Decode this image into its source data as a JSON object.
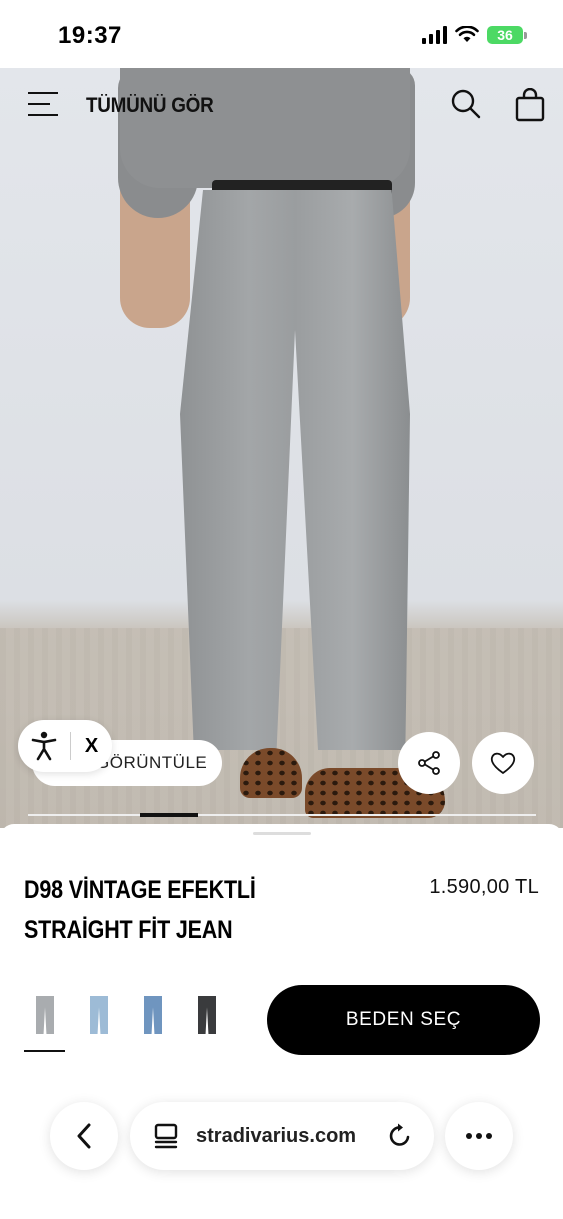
{
  "status_bar": {
    "time": "19:37",
    "battery": "36",
    "icons": [
      "cellular-signal-icon",
      "wifi-icon",
      "battery-charging-icon"
    ]
  },
  "header": {
    "title": "TÜMÜNÜ GÖR",
    "icons": [
      "menu-icon",
      "search-icon",
      "shopping-bag-icon"
    ]
  },
  "gallery": {
    "view_label": "GÖRÜNTÜLE",
    "accessibility_close": "X",
    "actions": [
      "share-icon",
      "heart-icon"
    ]
  },
  "product": {
    "title": "D98 VİNTAGE EFEKTLİ STRAİGHT FİT JEAN",
    "price": "1.590,00 TL",
    "size_button": "BEDEN SEÇ",
    "swatches": [
      {
        "name": "grey",
        "color": "#a9acaf",
        "selected": true
      },
      {
        "name": "light-blue",
        "color": "#9dbbd6",
        "selected": false
      },
      {
        "name": "mid-blue",
        "color": "#6f95bf",
        "selected": false
      },
      {
        "name": "black",
        "color": "#3a3b3d",
        "selected": false
      }
    ]
  },
  "browser": {
    "url": "stradivarius.com",
    "icons": [
      "back-chevron-icon",
      "tabs-icon",
      "reload-icon",
      "more-icon"
    ]
  },
  "colors": {
    "accent": "#000000",
    "battery": "#4cd964"
  }
}
